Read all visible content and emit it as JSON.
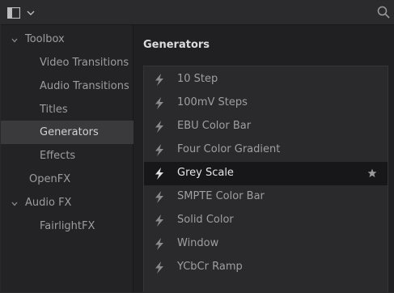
{
  "sidebar": {
    "items": [
      {
        "label": "Toolbox",
        "level": 0,
        "expanded": true,
        "selected": false
      },
      {
        "label": "Video Transitions",
        "level": 1,
        "selected": false
      },
      {
        "label": "Audio Transitions",
        "level": 1,
        "selected": false
      },
      {
        "label": "Titles",
        "level": 1,
        "selected": false
      },
      {
        "label": "Generators",
        "level": 1,
        "selected": true
      },
      {
        "label": "Effects",
        "level": 1,
        "selected": false
      },
      {
        "label": "OpenFX",
        "level": 0,
        "selected": false
      },
      {
        "label": "Audio FX",
        "level": 0,
        "expanded": true,
        "selected": false
      },
      {
        "label": "FairlightFX",
        "level": 1,
        "selected": false
      }
    ]
  },
  "main": {
    "title": "Generators",
    "items": [
      {
        "label": "10 Step",
        "selected": false,
        "favorite": false
      },
      {
        "label": "100mV Steps",
        "selected": false,
        "favorite": false
      },
      {
        "label": "EBU Color Bar",
        "selected": false,
        "favorite": false
      },
      {
        "label": "Four Color Gradient",
        "selected": false,
        "favorite": false
      },
      {
        "label": "Grey Scale",
        "selected": true,
        "favorite": true
      },
      {
        "label": "SMPTE Color Bar",
        "selected": false,
        "favorite": false
      },
      {
        "label": "Solid Color",
        "selected": false,
        "favorite": false
      },
      {
        "label": "Window",
        "selected": false,
        "favorite": false
      },
      {
        "label": "YCbCr Ramp",
        "selected": false,
        "favorite": false
      }
    ]
  },
  "icons": {
    "panel_toggle": "sidebar-panel-icon",
    "dropdown": "chevron-down-icon",
    "search": "search-icon",
    "expand": "chevron-down-icon",
    "generator": "lightning-bolt-icon",
    "favorite": "star-icon"
  },
  "colors": {
    "background": "#1f1f21",
    "sidebar_selected": "#3a3a3d",
    "list_selected": "#17171a",
    "text": "#a8a8a8",
    "text_highlight": "#e6e6e6"
  }
}
